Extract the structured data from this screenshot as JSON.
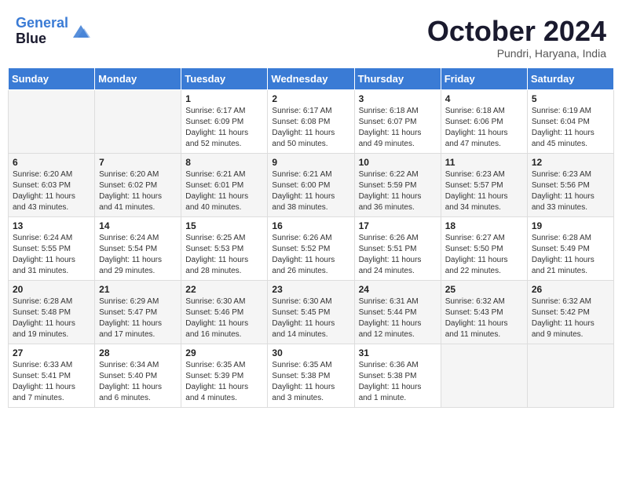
{
  "header": {
    "logo_line1": "General",
    "logo_line2": "Blue",
    "month": "October 2024",
    "location": "Pundri, Haryana, India"
  },
  "weekdays": [
    "Sunday",
    "Monday",
    "Tuesday",
    "Wednesday",
    "Thursday",
    "Friday",
    "Saturday"
  ],
  "weeks": [
    [
      {
        "day": "",
        "info": ""
      },
      {
        "day": "",
        "info": ""
      },
      {
        "day": "1",
        "info": "Sunrise: 6:17 AM\nSunset: 6:09 PM\nDaylight: 11 hours and 52 minutes."
      },
      {
        "day": "2",
        "info": "Sunrise: 6:17 AM\nSunset: 6:08 PM\nDaylight: 11 hours and 50 minutes."
      },
      {
        "day": "3",
        "info": "Sunrise: 6:18 AM\nSunset: 6:07 PM\nDaylight: 11 hours and 49 minutes."
      },
      {
        "day": "4",
        "info": "Sunrise: 6:18 AM\nSunset: 6:06 PM\nDaylight: 11 hours and 47 minutes."
      },
      {
        "day": "5",
        "info": "Sunrise: 6:19 AM\nSunset: 6:04 PM\nDaylight: 11 hours and 45 minutes."
      }
    ],
    [
      {
        "day": "6",
        "info": "Sunrise: 6:20 AM\nSunset: 6:03 PM\nDaylight: 11 hours and 43 minutes."
      },
      {
        "day": "7",
        "info": "Sunrise: 6:20 AM\nSunset: 6:02 PM\nDaylight: 11 hours and 41 minutes."
      },
      {
        "day": "8",
        "info": "Sunrise: 6:21 AM\nSunset: 6:01 PM\nDaylight: 11 hours and 40 minutes."
      },
      {
        "day": "9",
        "info": "Sunrise: 6:21 AM\nSunset: 6:00 PM\nDaylight: 11 hours and 38 minutes."
      },
      {
        "day": "10",
        "info": "Sunrise: 6:22 AM\nSunset: 5:59 PM\nDaylight: 11 hours and 36 minutes."
      },
      {
        "day": "11",
        "info": "Sunrise: 6:23 AM\nSunset: 5:57 PM\nDaylight: 11 hours and 34 minutes."
      },
      {
        "day": "12",
        "info": "Sunrise: 6:23 AM\nSunset: 5:56 PM\nDaylight: 11 hours and 33 minutes."
      }
    ],
    [
      {
        "day": "13",
        "info": "Sunrise: 6:24 AM\nSunset: 5:55 PM\nDaylight: 11 hours and 31 minutes."
      },
      {
        "day": "14",
        "info": "Sunrise: 6:24 AM\nSunset: 5:54 PM\nDaylight: 11 hours and 29 minutes."
      },
      {
        "day": "15",
        "info": "Sunrise: 6:25 AM\nSunset: 5:53 PM\nDaylight: 11 hours and 28 minutes."
      },
      {
        "day": "16",
        "info": "Sunrise: 6:26 AM\nSunset: 5:52 PM\nDaylight: 11 hours and 26 minutes."
      },
      {
        "day": "17",
        "info": "Sunrise: 6:26 AM\nSunset: 5:51 PM\nDaylight: 11 hours and 24 minutes."
      },
      {
        "day": "18",
        "info": "Sunrise: 6:27 AM\nSunset: 5:50 PM\nDaylight: 11 hours and 22 minutes."
      },
      {
        "day": "19",
        "info": "Sunrise: 6:28 AM\nSunset: 5:49 PM\nDaylight: 11 hours and 21 minutes."
      }
    ],
    [
      {
        "day": "20",
        "info": "Sunrise: 6:28 AM\nSunset: 5:48 PM\nDaylight: 11 hours and 19 minutes."
      },
      {
        "day": "21",
        "info": "Sunrise: 6:29 AM\nSunset: 5:47 PM\nDaylight: 11 hours and 17 minutes."
      },
      {
        "day": "22",
        "info": "Sunrise: 6:30 AM\nSunset: 5:46 PM\nDaylight: 11 hours and 16 minutes."
      },
      {
        "day": "23",
        "info": "Sunrise: 6:30 AM\nSunset: 5:45 PM\nDaylight: 11 hours and 14 minutes."
      },
      {
        "day": "24",
        "info": "Sunrise: 6:31 AM\nSunset: 5:44 PM\nDaylight: 11 hours and 12 minutes."
      },
      {
        "day": "25",
        "info": "Sunrise: 6:32 AM\nSunset: 5:43 PM\nDaylight: 11 hours and 11 minutes."
      },
      {
        "day": "26",
        "info": "Sunrise: 6:32 AM\nSunset: 5:42 PM\nDaylight: 11 hours and 9 minutes."
      }
    ],
    [
      {
        "day": "27",
        "info": "Sunrise: 6:33 AM\nSunset: 5:41 PM\nDaylight: 11 hours and 7 minutes."
      },
      {
        "day": "28",
        "info": "Sunrise: 6:34 AM\nSunset: 5:40 PM\nDaylight: 11 hours and 6 minutes."
      },
      {
        "day": "29",
        "info": "Sunrise: 6:35 AM\nSunset: 5:39 PM\nDaylight: 11 hours and 4 minutes."
      },
      {
        "day": "30",
        "info": "Sunrise: 6:35 AM\nSunset: 5:38 PM\nDaylight: 11 hours and 3 minutes."
      },
      {
        "day": "31",
        "info": "Sunrise: 6:36 AM\nSunset: 5:38 PM\nDaylight: 11 hours and 1 minute."
      },
      {
        "day": "",
        "info": ""
      },
      {
        "day": "",
        "info": ""
      }
    ]
  ]
}
